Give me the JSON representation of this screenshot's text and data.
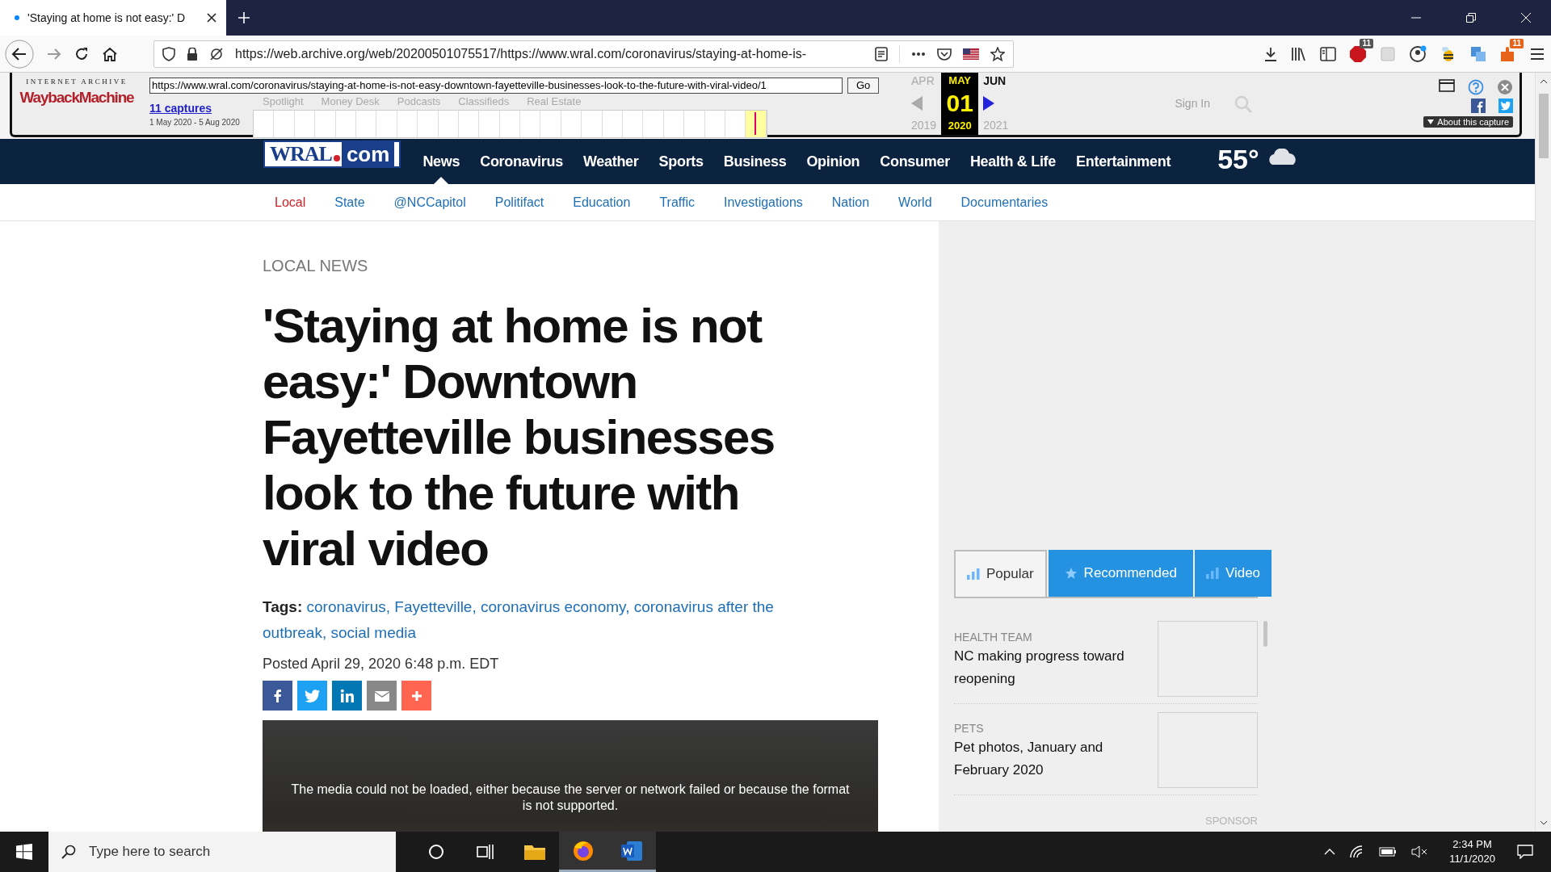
{
  "browser": {
    "tab_title": "'Staying at home is not easy:' D",
    "url": "https://web.archive.org/web/20200501075517/https://www.wral.com/coronavirus/staying-at-home-is-",
    "abp_badge": "11",
    "ext_badge": "11"
  },
  "wayback": {
    "brand_top": "INTERNET ARCHIVE",
    "brand": "WaybackMachine",
    "url_value": "https://www.wral.com/coronavirus/staying-at-home-is-not-easy-downtown-fayetteville-businesses-look-to-the-future-with-viral-video/1",
    "go": "Go",
    "captures": "11 captures",
    "range": "1 May 2020 - 5 Aug 2020",
    "prev_month": "APR",
    "month": "MAY",
    "day": "01",
    "year": "2020",
    "next_month": "JUN",
    "prev_year": "2019",
    "next_year": "2021",
    "about": "About this capture"
  },
  "site_top": {
    "links": [
      "Spotlight",
      "Money Desk",
      "Podcasts",
      "Classifieds",
      "Real Estate"
    ],
    "sign_in": "Sign In"
  },
  "logo": {
    "name": "WRAL",
    "tld": "com"
  },
  "nav": [
    {
      "label": "News",
      "selected": true
    },
    {
      "label": "Coronavirus",
      "selected": false
    },
    {
      "label": "Weather",
      "selected": false
    },
    {
      "label": "Sports",
      "selected": false
    },
    {
      "label": "Business",
      "selected": false
    },
    {
      "label": "Opinion",
      "selected": false
    },
    {
      "label": "Consumer",
      "selected": false
    },
    {
      "label": "Health & Life",
      "selected": false
    },
    {
      "label": "Entertainment",
      "selected": false
    }
  ],
  "temperature": "55°",
  "subnav": [
    {
      "label": "Local",
      "selected": true
    },
    {
      "label": "State",
      "selected": false
    },
    {
      "label": "@NCCapitol",
      "selected": false
    },
    {
      "label": "Politifact",
      "selected": false
    },
    {
      "label": "Education",
      "selected": false
    },
    {
      "label": "Traffic",
      "selected": false
    },
    {
      "label": "Investigations",
      "selected": false
    },
    {
      "label": "Nation",
      "selected": false
    },
    {
      "label": "World",
      "selected": false
    },
    {
      "label": "Documentaries",
      "selected": false
    }
  ],
  "article": {
    "section": "LOCAL NEWS",
    "headline": "'Staying at home is not easy:' Downtown Fayetteville businesses look to the future with viral video",
    "tags_label": "Tags:",
    "tags": [
      "coronavirus,",
      "Fayetteville,",
      "coronavirus economy,",
      "coronavirus after the outbreak,",
      "social media"
    ],
    "posted": "Posted April 29, 2020 6:48 p.m. EDT",
    "share": [
      {
        "kind": "facebook"
      },
      {
        "kind": "twitter"
      },
      {
        "kind": "linkedin"
      },
      {
        "kind": "email"
      },
      {
        "kind": "more"
      }
    ],
    "media_error": "The media could not be loaded, either because the server or network failed or because the format is not supported."
  },
  "sidebar": {
    "tabs": [
      {
        "label": "Popular",
        "selected": true
      },
      {
        "label": "Recommended",
        "selected": false
      },
      {
        "label": "Video",
        "selected": false
      }
    ],
    "stories": [
      {
        "category": "HEALTH TEAM",
        "title": "NC making progress toward reopening"
      },
      {
        "category": "PETS",
        "title": "Pet photos, January and February 2020"
      }
    ],
    "sponsor": "SPONSOR"
  },
  "taskbar": {
    "search_placeholder": "Type here to search",
    "time": "2:34 PM",
    "date": "11/1/2020"
  }
}
